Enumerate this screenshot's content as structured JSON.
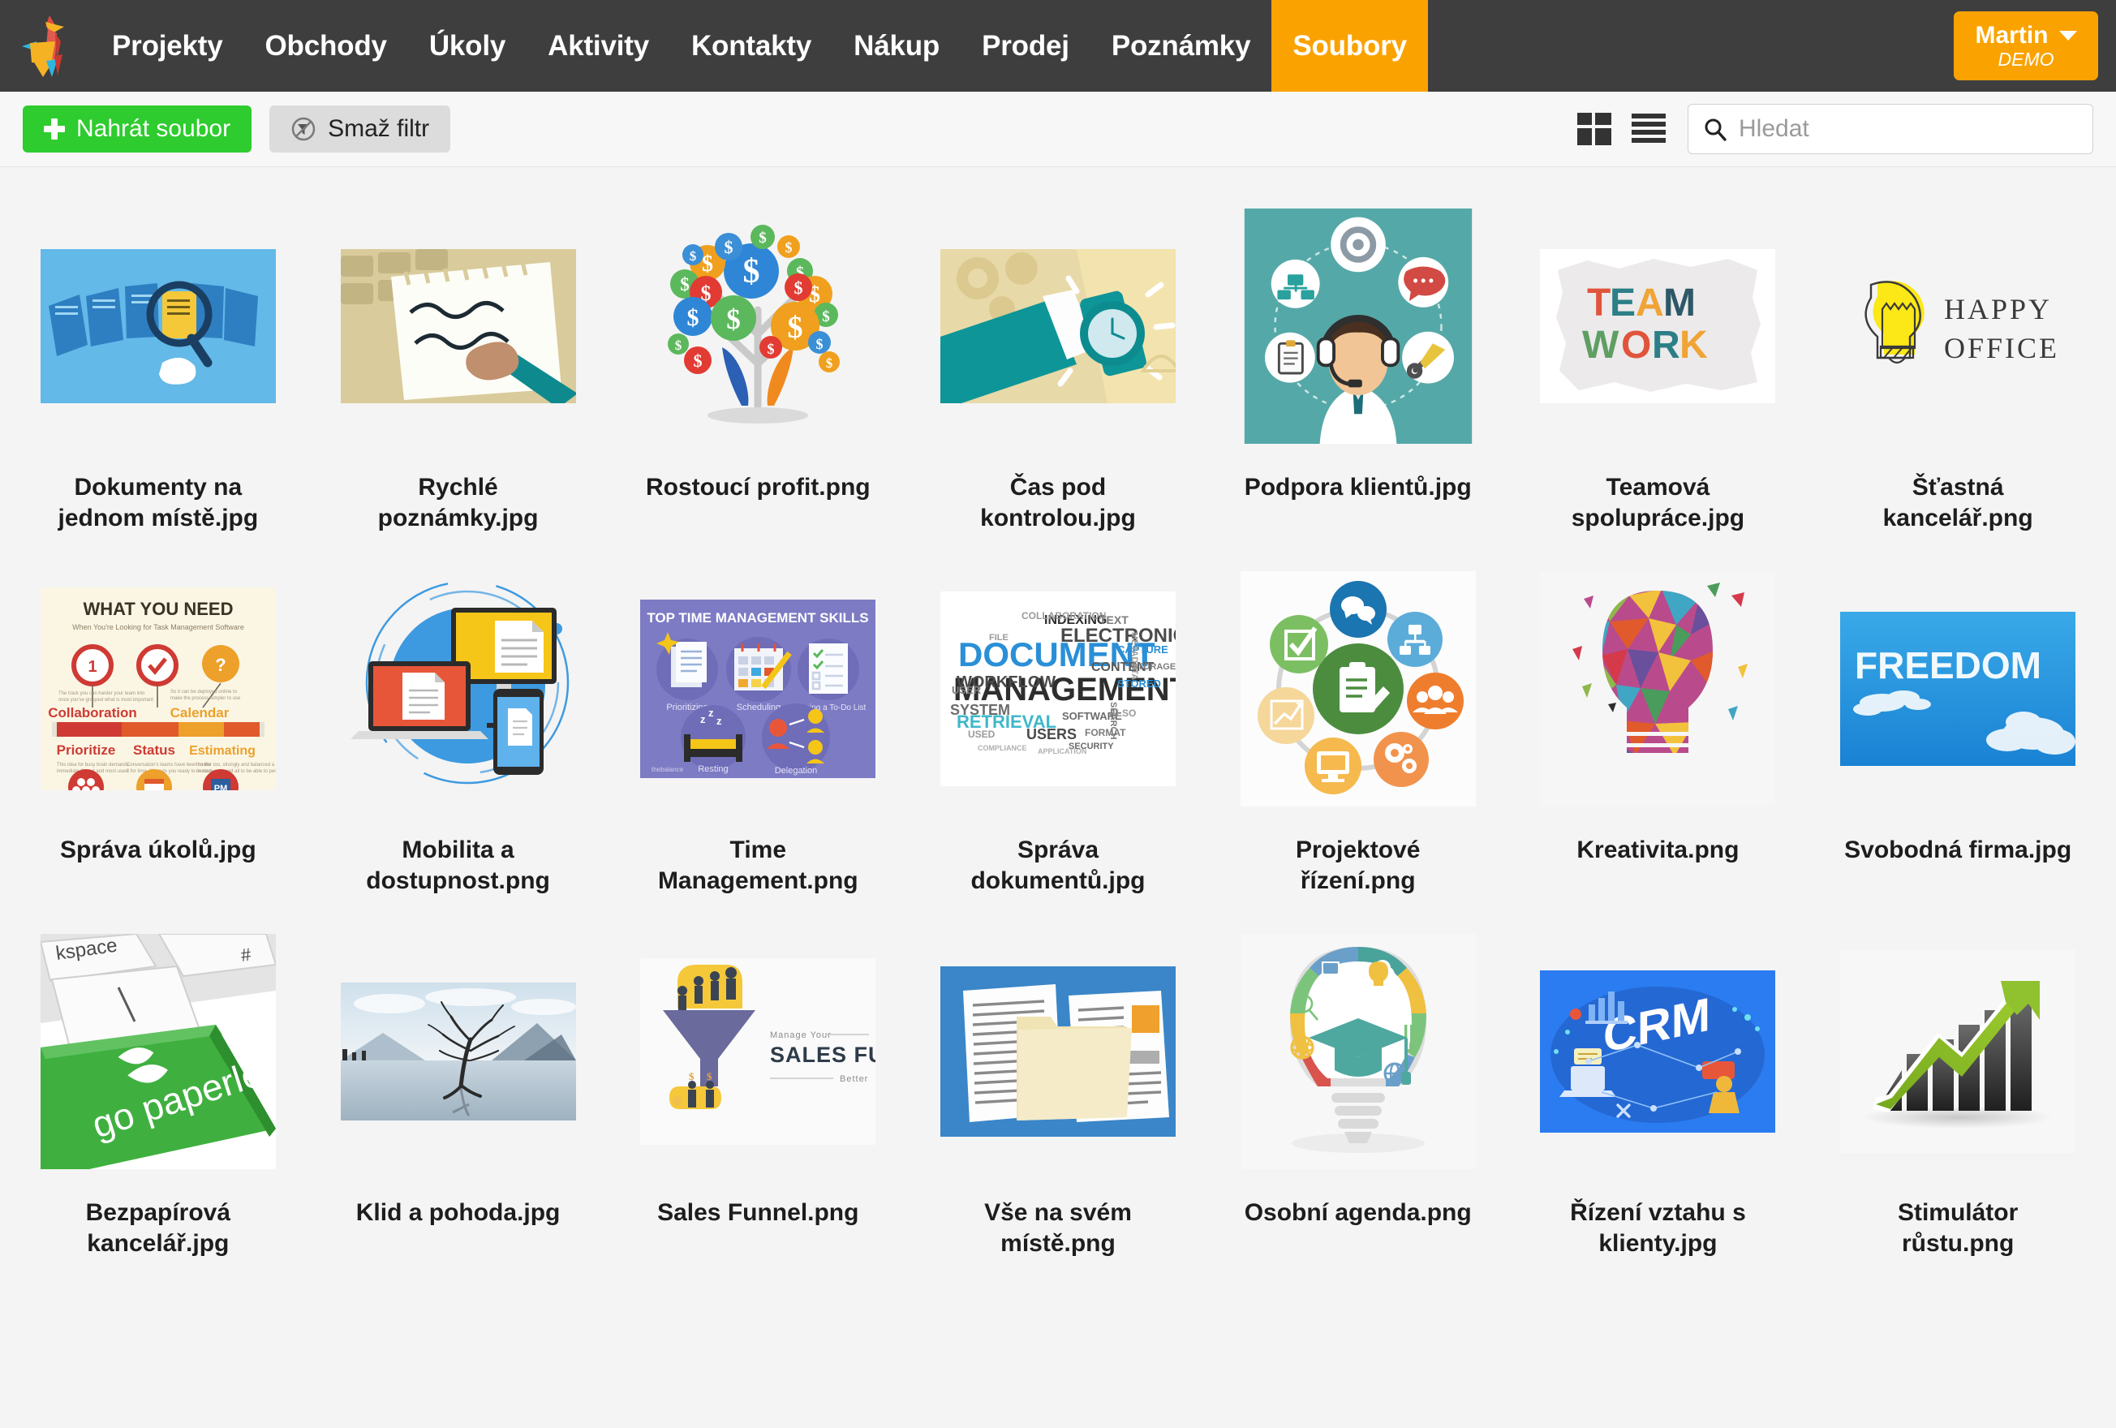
{
  "navbar": {
    "logo_icon": "origami-llama-logo",
    "items": [
      {
        "label": "Projekty",
        "active": false
      },
      {
        "label": "Obchody",
        "active": false
      },
      {
        "label": "Úkoly",
        "active": false
      },
      {
        "label": "Aktivity",
        "active": false
      },
      {
        "label": "Kontakty",
        "active": false
      },
      {
        "label": "Nákup",
        "active": false
      },
      {
        "label": "Prodej",
        "active": false
      },
      {
        "label": "Poznámky",
        "active": false
      },
      {
        "label": "Soubory",
        "active": true
      }
    ],
    "user": {
      "name": "Martin",
      "subtitle": "DEMO",
      "caret_icon": "chevron-down-icon"
    },
    "colors": {
      "background": "#3e3e3e",
      "accent": "#faa200"
    }
  },
  "toolbar": {
    "upload_label": "Nahrát soubor",
    "upload_icon": "plus-icon",
    "upload_color": "#2ecc2e",
    "clear_filter_label": "Smaž filtr",
    "clear_filter_icon": "filter-off-icon",
    "grid_view_icon": "grid-view-icon",
    "list_view_icon": "list-view-icon",
    "search_icon": "search-icon",
    "search_placeholder": "Hledat",
    "search_value": ""
  },
  "files": [
    {
      "name": "Dokumenty na jednom místě.jpg",
      "thumb": "documents-search-magnifier"
    },
    {
      "name": "Rychlé poznámky.jpg",
      "thumb": "notepad-hand-pen"
    },
    {
      "name": "Rostoucí profit.png",
      "thumb": "money-tree-dollar-coins"
    },
    {
      "name": "Čas pod kontrolou.jpg",
      "thumb": "wristwatch-time"
    },
    {
      "name": "Podpora klientů.jpg",
      "thumb": "support-agent-headset"
    },
    {
      "name": "Teamová spolupráce.jpg",
      "thumb": "teamwork-torn-paper"
    },
    {
      "name": "Šťastná kancelář.png",
      "thumb": "happy-office-lightbulb"
    },
    {
      "name": "Správa úkolů.jpg",
      "thumb": "what-you-need-infographic"
    },
    {
      "name": "Mobilita a dostupnost.png",
      "thumb": "multi-device-documents"
    },
    {
      "name": "Time Management.png",
      "thumb": "time-management-skills"
    },
    {
      "name": "Správa dokumentů.jpg",
      "thumb": "document-management-wordcloud"
    },
    {
      "name": "Projektové řízení.png",
      "thumb": "project-management-circle"
    },
    {
      "name": "Kreativita.png",
      "thumb": "colorful-mosaic-lightbulb"
    },
    {
      "name": "Svobodná firma.jpg",
      "thumb": "freedom-clouds-sky"
    },
    {
      "name": "Bezpapírová kancelář.jpg",
      "thumb": "go-paperless-key"
    },
    {
      "name": "Klid a pohoda.jpg",
      "thumb": "lake-tree-landscape"
    },
    {
      "name": "Sales Funnel.png",
      "thumb": "sales-funnel-graphic"
    },
    {
      "name": "Vše na svém místě.png",
      "thumb": "folder-documents-blue"
    },
    {
      "name": "Osobní agenda.png",
      "thumb": "education-lightbulb-cap"
    },
    {
      "name": "Řízení vztahu s klienty.jpg",
      "thumb": "crm-isometric-blue"
    },
    {
      "name": "Stimulátor růstu.png",
      "thumb": "growth-chart-arrow"
    }
  ]
}
